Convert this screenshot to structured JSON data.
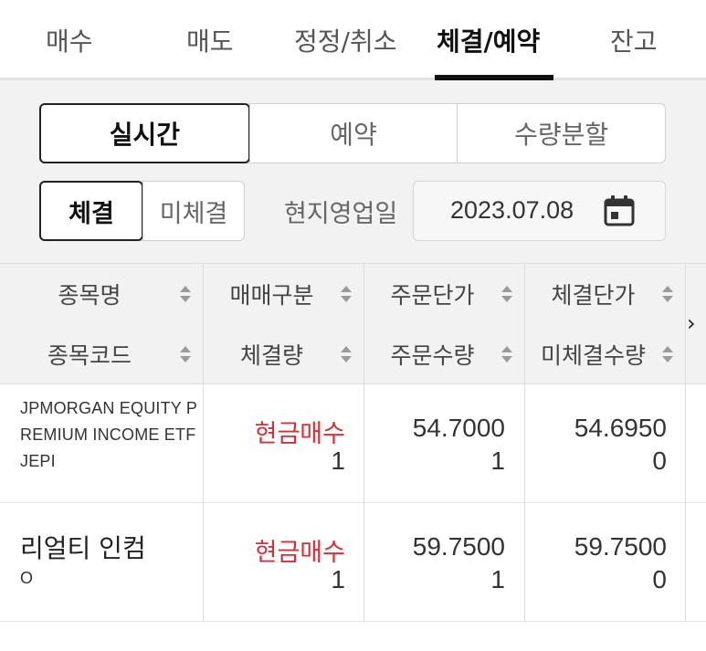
{
  "tabs": [
    {
      "label": "매수",
      "active": false
    },
    {
      "label": "매도",
      "active": false
    },
    {
      "label": "정정/취소",
      "active": false
    },
    {
      "label": "체결/예약",
      "active": true
    },
    {
      "label": "잔고",
      "active": false
    }
  ],
  "mode_segment": [
    {
      "label": "실시간",
      "active": true
    },
    {
      "label": "예약",
      "active": false
    },
    {
      "label": "수량분할",
      "active": false
    }
  ],
  "status_segment": [
    {
      "label": "체결",
      "active": true
    },
    {
      "label": "미체결",
      "active": false
    }
  ],
  "date_filter": {
    "label": "현지영업일",
    "value": "2023.07.08",
    "icon": "calendar-icon"
  },
  "table": {
    "headers_top": [
      "종목명",
      "매매구분",
      "주문단가",
      "체결단가"
    ],
    "headers_bottom": [
      "종목코드",
      "체결량",
      "주문수량",
      "미체결수량"
    ],
    "scroll_icon": "chevron-right-icon",
    "rows": [
      {
        "name_line1": "JPMORGAN EQUITY P",
        "name_line2": "REMIUM INCOME ETF",
        "code": "JEPI",
        "trade_type": "현금매수",
        "filled_qty": "1",
        "order_price": "54.7000",
        "order_qty": "1",
        "fill_price": "54.6950",
        "unfilled_qty": "0"
      },
      {
        "name": "리얼티 인컴",
        "code": "O",
        "trade_type": "현금매수",
        "filled_qty": "1",
        "order_price": "59.7500",
        "order_qty": "1",
        "fill_price": "59.7500",
        "unfilled_qty": "0"
      }
    ]
  },
  "colors": {
    "buy": "#d3303a",
    "panel": "#f2f2f2",
    "active_border": "#222222"
  }
}
